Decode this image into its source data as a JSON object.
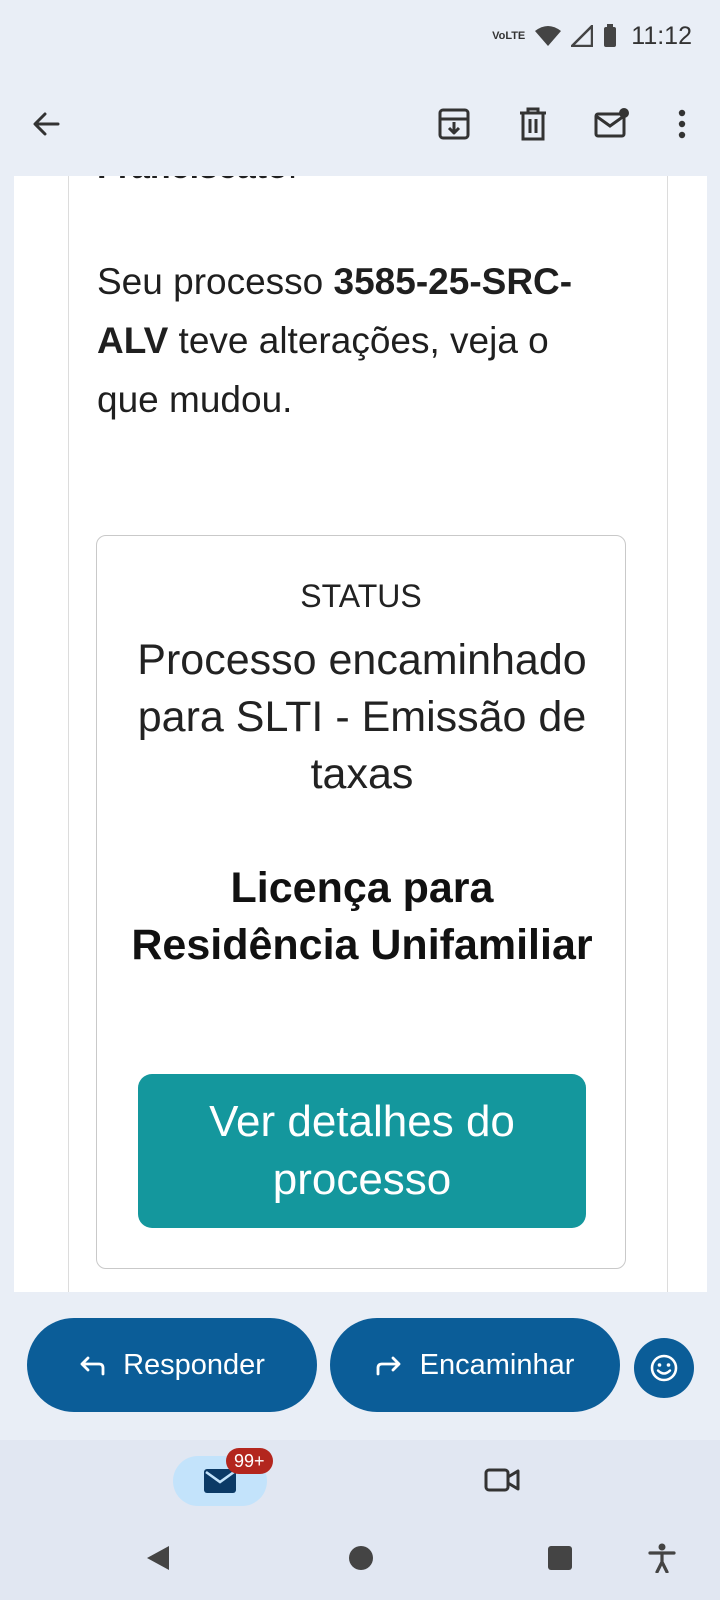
{
  "status_bar": {
    "network_label_top": "Vo",
    "network_label_bottom": "LTE",
    "time": "11:12"
  },
  "toolbar": {
    "back_icon": "arrow-left-icon",
    "archive_icon": "archive-icon",
    "delete_icon": "trash-icon",
    "mark_unread_icon": "mail-unread-icon",
    "more_icon": "more-vert-icon"
  },
  "email": {
    "greeting_name": "Franciscato",
    "greeting_punct": "!",
    "intro_pre": "Seu processo ",
    "process_number": "3585-25-SRC-ALV",
    "intro_post": " teve alterações, veja o que mudou.",
    "status_label": "STATUS",
    "status_text": "Processo encaminhado para SLTI - Emissão de taxas",
    "license_type": "Licença para Residência Unifamiliar",
    "details_button": "Ver detalhes do processo"
  },
  "actions": {
    "reply_label": "Responder",
    "forward_label": "Encaminhar",
    "emoji_icon": "emoji-smile-icon"
  },
  "bottom_nav": {
    "mail_badge": "99+",
    "mail_icon": "mail-icon",
    "video_icon": "videocam-icon"
  },
  "colors": {
    "accent_teal": "#14979d",
    "primary_blue": "#0b5d98",
    "badge_red": "#b3261e"
  }
}
